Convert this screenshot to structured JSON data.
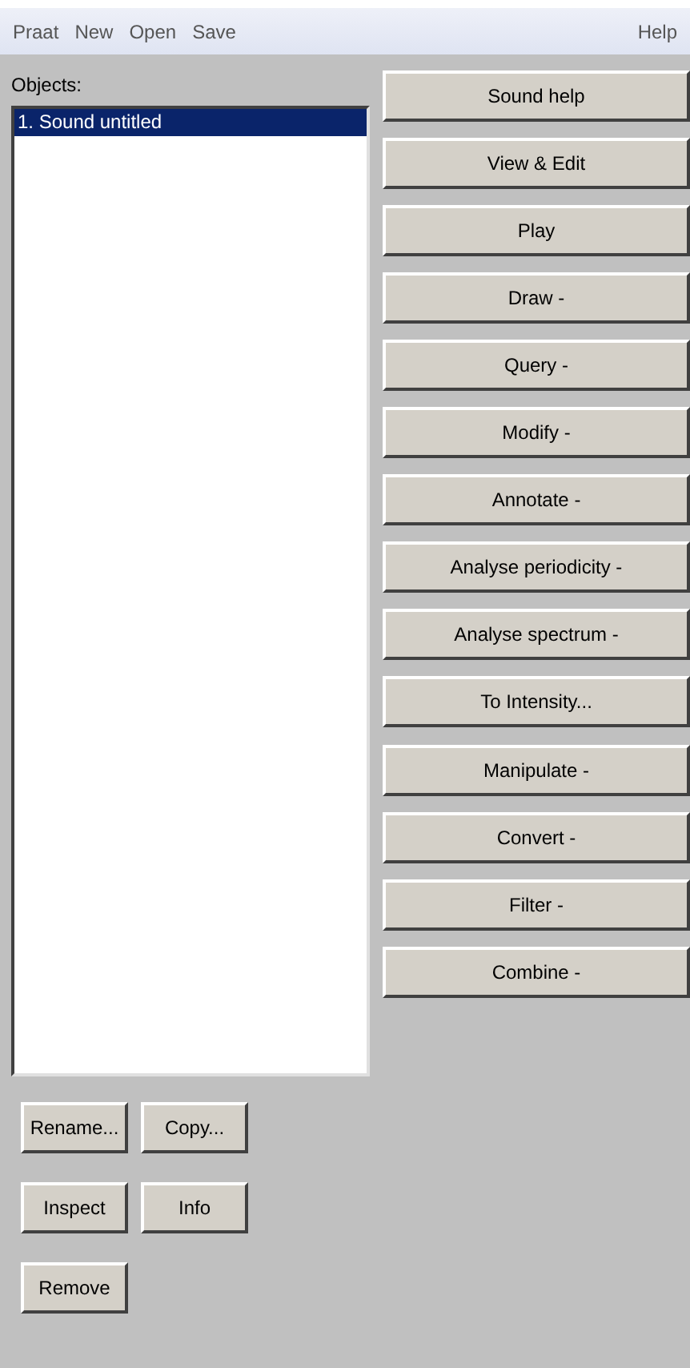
{
  "menu_bar": {
    "items": [
      "Praat",
      "New",
      "Open",
      "Save"
    ],
    "help": "Help"
  },
  "objects": {
    "label": "Objects:",
    "items": [
      {
        "label": "1. Sound untitled",
        "selected": true
      }
    ]
  },
  "action_groups": [
    [
      "Sound help",
      "View & Edit",
      "Play",
      "Draw -",
      "Query -",
      "Modify -",
      "Annotate -",
      "Analyse periodicity -",
      "Analyse spectrum -",
      "To Intensity..."
    ],
    [
      "Manipulate -",
      "Convert -",
      "Filter -",
      "Combine -"
    ]
  ],
  "bottom_buttons": [
    [
      "Rename...",
      "Copy..."
    ],
    [
      "Inspect",
      "Info"
    ],
    [
      "Remove"
    ]
  ]
}
